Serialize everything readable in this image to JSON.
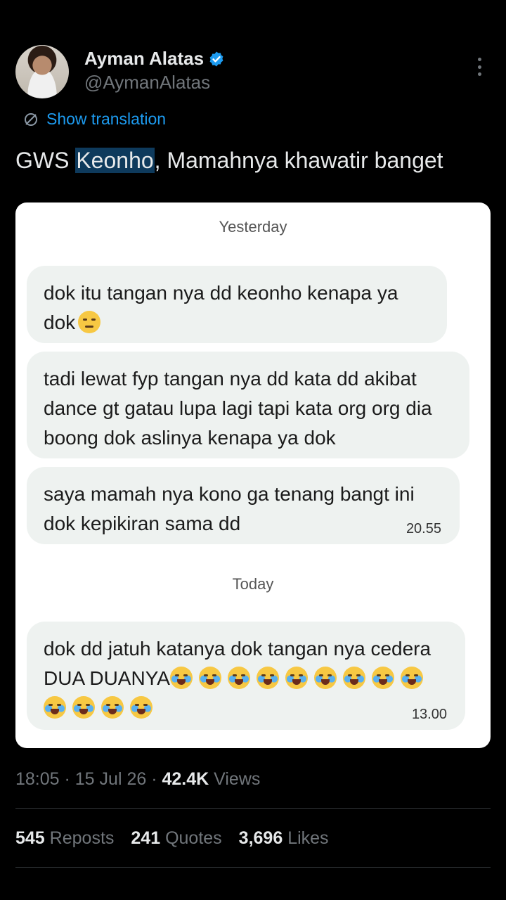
{
  "author": {
    "name": "Ayman Alatas",
    "handle": "@AymanAlatas"
  },
  "translate_label": "Show translation",
  "tweet": {
    "before": "GWS ",
    "highlight": "Keonho",
    "after": ", Mamahnya khawatir banget"
  },
  "chat": {
    "day1": "Yesterday",
    "msg1": "dok itu tangan nya dd keonho kenapa ya dok",
    "msg2": "tadi lewat fyp tangan nya dd kata dd akibat dance gt gatau lupa lagi tapi kata org org dia boong dok aslinya kenapa ya dok",
    "msg3": "saya mamah nya kono ga tenang bangt ini dok kepikiran sama dd",
    "msg3_time": "20.55",
    "day2": "Today",
    "msg4": "dok dd jatuh katanya dok tangan nya cedera DUA DUANYA",
    "msg4_time": "13.00"
  },
  "meta": {
    "time": "18:05",
    "sep": " · ",
    "date": "15 Jul 26",
    "views_count": "42.4K",
    "views_label": "Views"
  },
  "stats": {
    "reposts_count": "545",
    "reposts_label": "Reposts",
    "quotes_count": "241",
    "quotes_label": "Quotes",
    "likes_count": "3,696",
    "likes_label": "Likes"
  },
  "colors": {
    "accent": "#1d9bf0",
    "background": "#000000",
    "card": "#ffffff",
    "bubble": "#eef2f0"
  }
}
